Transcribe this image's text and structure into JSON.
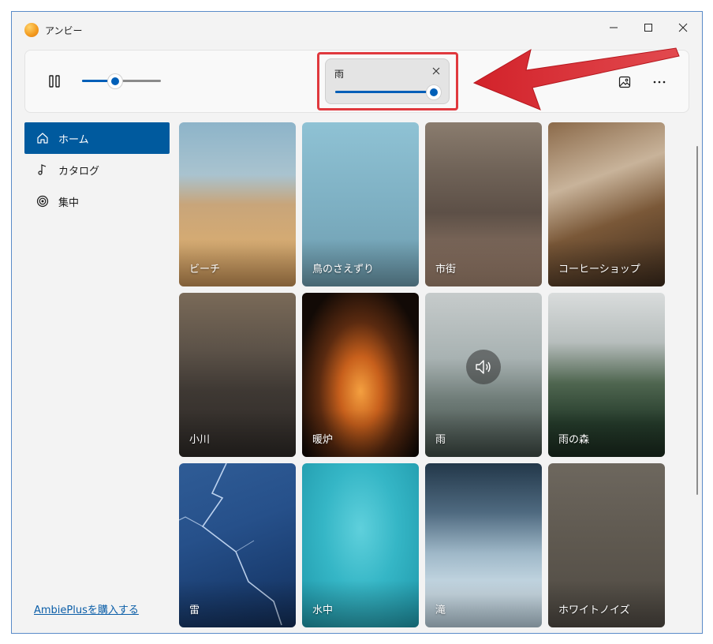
{
  "window": {
    "title": "アンビー"
  },
  "player": {
    "master_volume": 0.42,
    "flyout": {
      "title": "雨",
      "volume": 0.93
    }
  },
  "sidebar": {
    "items": [
      {
        "label": "ホーム",
        "icon": "home-icon",
        "active": true
      },
      {
        "label": "カタログ",
        "icon": "music-note-icon",
        "active": false
      },
      {
        "label": "集中",
        "icon": "target-icon",
        "active": false
      }
    ],
    "buy_link": "AmbiePlusを購入する"
  },
  "sounds": [
    {
      "label": "ビーチ"
    },
    {
      "label": "鳥のさえずり"
    },
    {
      "label": "市街"
    },
    {
      "label": "コーヒーショップ"
    },
    {
      "label": "小川"
    },
    {
      "label": "暖炉"
    },
    {
      "label": "雨",
      "playing": true
    },
    {
      "label": "雨の森"
    },
    {
      "label": "雷"
    },
    {
      "label": "水中"
    },
    {
      "label": "滝"
    },
    {
      "label": "ホワイトノイズ"
    }
  ],
  "colors": {
    "accent": "#005fb8",
    "annotation": "#e0393e"
  }
}
